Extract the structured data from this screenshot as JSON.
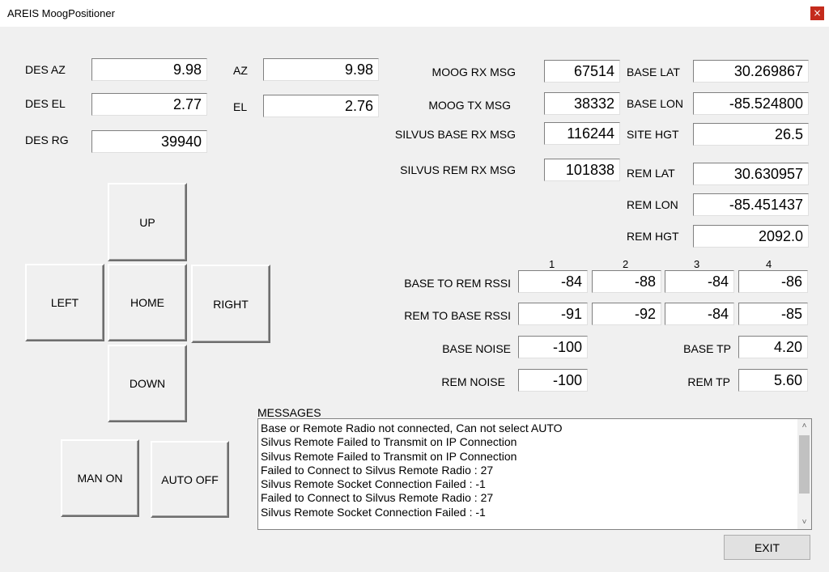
{
  "window": {
    "title": "AREIS MoogPositioner",
    "close_glyph": "×"
  },
  "desired": {
    "az_label": "DES AZ",
    "az_value": "9.98",
    "el_label": "DES EL",
    "el_value": "2.77",
    "rg_label": "DES RG",
    "rg_value": "39940"
  },
  "actual": {
    "az_label": "AZ",
    "az_value": "9.98",
    "el_label": "EL",
    "el_value": "2.76"
  },
  "counters": {
    "moog_rx_label": "MOOG RX MSG",
    "moog_rx_value": "67514",
    "moog_tx_label": "MOOG TX MSG",
    "moog_tx_value": "38332",
    "silvus_base_rx_label": "SILVUS BASE RX MSG",
    "silvus_base_rx_value": "116244",
    "silvus_rem_rx_label": "SILVUS REM RX MSG",
    "silvus_rem_rx_value": "101838"
  },
  "positions": {
    "base_lat_label": "BASE LAT",
    "base_lat_value": "30.269867",
    "base_lon_label": "BASE LON",
    "base_lon_value": "-85.524800",
    "site_hgt_label": "SITE HGT",
    "site_hgt_value": "26.5",
    "rem_lat_label": "REM LAT",
    "rem_lat_value": "30.630957",
    "rem_lon_label": "REM LON",
    "rem_lon_value": "-85.451437",
    "rem_hgt_label": "REM HGT",
    "rem_hgt_value": "2092.0"
  },
  "controls": {
    "up": "UP",
    "left": "LEFT",
    "home": "HOME",
    "right": "RIGHT",
    "down": "DOWN",
    "man": "MAN ON",
    "auto": "AUTO OFF",
    "exit": "EXIT"
  },
  "rssi": {
    "columns": [
      "1",
      "2",
      "3",
      "4"
    ],
    "base_to_rem_label": "BASE TO REM RSSI",
    "base_to_rem": [
      "-84",
      "-88",
      "-84",
      "-86"
    ],
    "rem_to_base_label": "REM TO BASE RSSI",
    "rem_to_base": [
      "-91",
      "-92",
      "-84",
      "-85"
    ]
  },
  "noise": {
    "base_noise_label": "BASE NOISE",
    "base_noise_value": "-100",
    "rem_noise_label": "REM NOISE",
    "rem_noise_value": "-100",
    "base_tp_label": "BASE TP",
    "base_tp_value": "4.20",
    "rem_tp_label": "REM TP",
    "rem_tp_value": "5.60"
  },
  "messages": {
    "label": "MESSAGES",
    "lines": [
      "Base or Remote Radio not connected, Can not select AUTO",
      "Silvus Remote Failed to Transmit on IP Connection",
      "Silvus Remote Failed to Transmit on IP Connection",
      "Failed to Connect to Silvus Remote Radio : 27",
      "Silvus Remote Socket Connection Failed : -1",
      "Failed to Connect to Silvus Remote Radio : 27",
      "Silvus Remote Socket Connection Failed : -1"
    ],
    "scroll_up": "˄",
    "scroll_down": "˅"
  }
}
